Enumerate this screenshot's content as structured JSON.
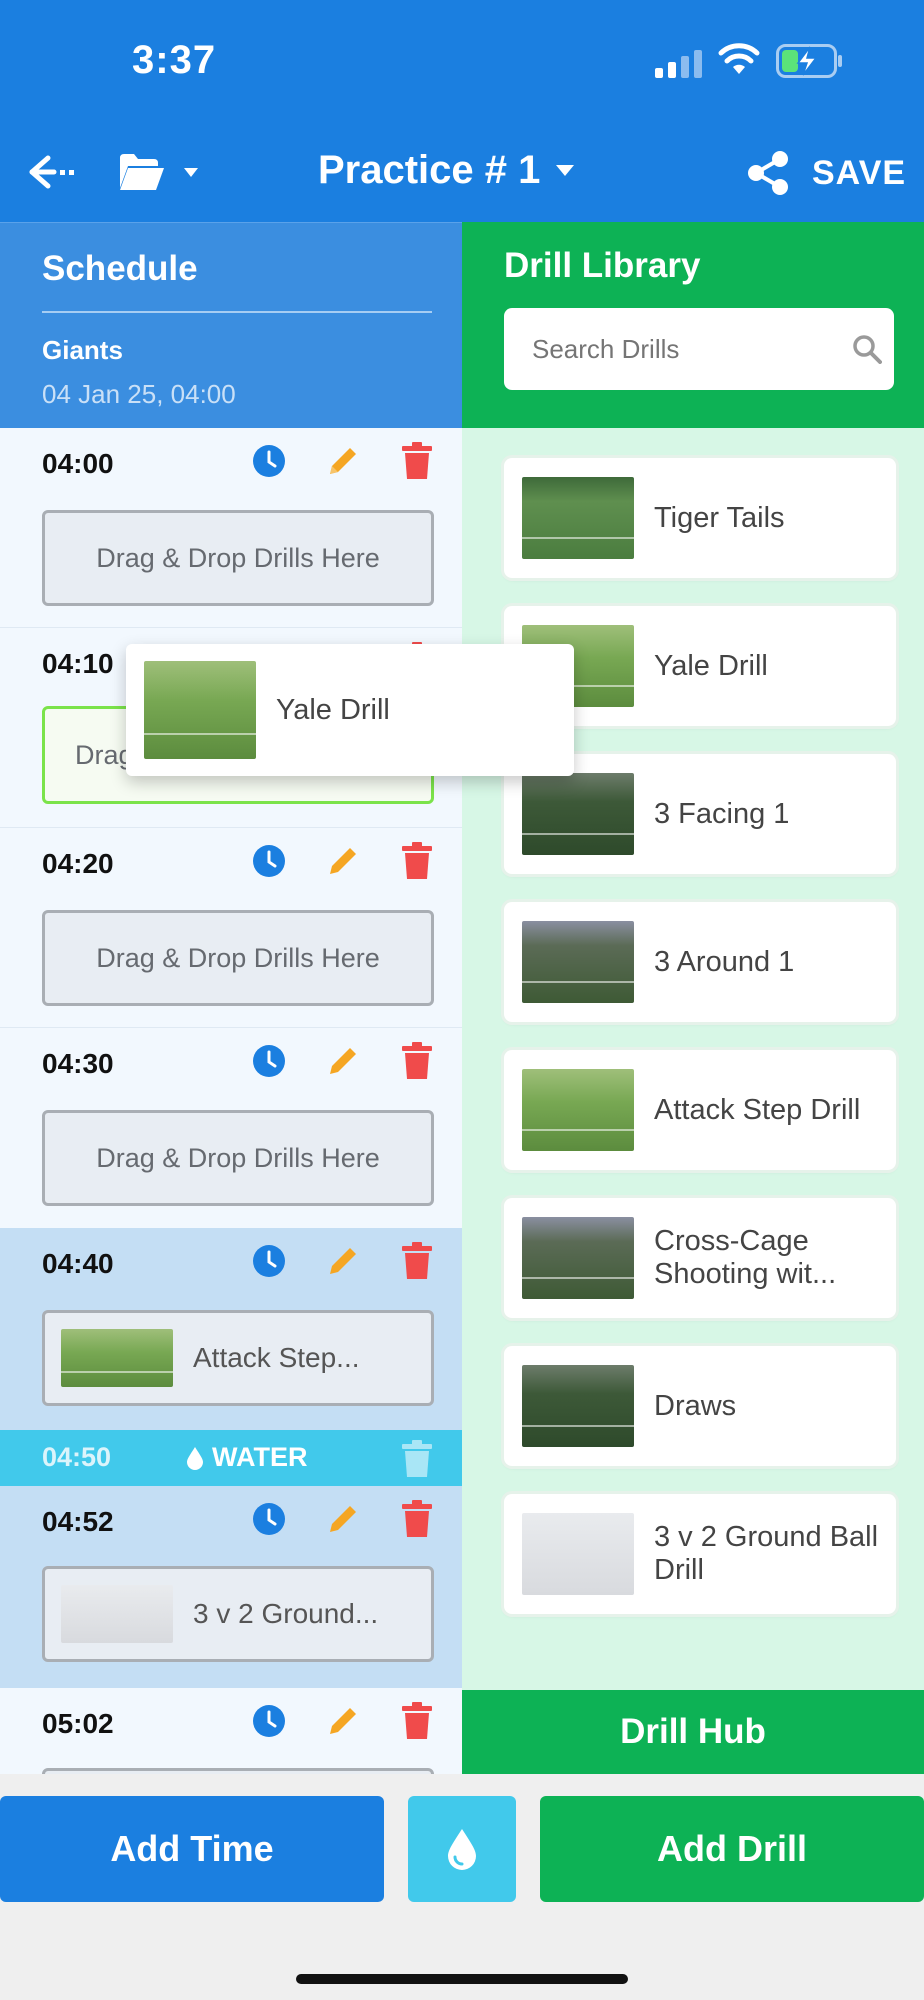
{
  "status": {
    "time": "3:37"
  },
  "header": {
    "title": "Practice # 1",
    "save_label": "SAVE"
  },
  "schedule": {
    "title": "Schedule",
    "team": "Giants",
    "datetime": "04 Jan 25, 04:00",
    "empty_label": "Drag & Drop Drills Here",
    "active_empty_label": "Drag",
    "slots": [
      {
        "time": "04:00"
      },
      {
        "time": "04:10"
      },
      {
        "time": "04:20"
      },
      {
        "time": "04:30"
      },
      {
        "time": "04:40",
        "drill": "Attack Step..."
      },
      {
        "time": "04:52",
        "drill": "3 v 2 Ground..."
      },
      {
        "time": "05:02"
      }
    ],
    "water": {
      "time": "04:50",
      "label": "WATER"
    }
  },
  "library": {
    "title": "Drill Library",
    "search_placeholder": "Search Drills",
    "drills": [
      {
        "name": "Tiger Tails"
      },
      {
        "name": "Yale Drill"
      },
      {
        "name": "3 Facing 1"
      },
      {
        "name": "3 Around 1"
      },
      {
        "name": "Attack Step Drill"
      },
      {
        "name": "Cross-Cage Shooting wit..."
      },
      {
        "name": "Draws"
      },
      {
        "name": "3 v 2 Ground Ball Drill"
      }
    ],
    "hub_label": "Drill Hub"
  },
  "dragging": {
    "name": "Yale Drill"
  },
  "bottom": {
    "add_time": "Add Time",
    "add_drill": "Add Drill"
  },
  "colors": {
    "primary_blue": "#1b7fe0",
    "green": "#0db255",
    "water": "#41c9eb",
    "danger": "#f04b4b",
    "edit": "#f5a623"
  }
}
